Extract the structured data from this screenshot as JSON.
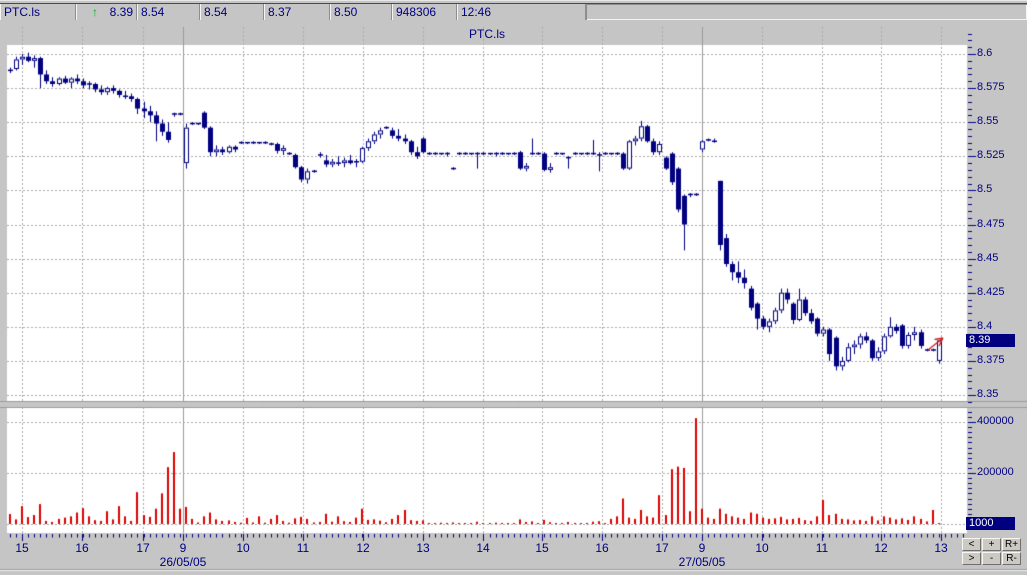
{
  "quote_bar": {
    "symbol": "PTC.ls",
    "up_arrow": "↑",
    "last": "8.39",
    "values": [
      "8.54",
      "8.54",
      "8.37",
      "8.50"
    ],
    "volume": "948306",
    "time": "12:46"
  },
  "nav": {
    "buttons": [
      "<",
      "+",
      "R+",
      ">",
      "-",
      "R-"
    ]
  },
  "colors": {
    "chrome": "#c5c5c5",
    "plot_bg": "#ffffff",
    "navy": "#000080",
    "grid": "#ababab",
    "separator": "#9a9a9a",
    "volume_red": "#dd0000",
    "arrow_red": "#cc2222",
    "up_green": "#00b31e",
    "highlight_bg": "#000080",
    "highlight_text": "#ffffff"
  },
  "chart_data": {
    "type": "candlestick_with_volume",
    "title": "PTC.ls",
    "last_price_label": "8.39",
    "last_volume_label": "1000",
    "y_axis_labels": [
      "8.6",
      "8.575",
      "8.55",
      "8.525",
      "8.5",
      "8.475",
      "8.45",
      "8.425",
      "8.4",
      "8.375",
      "8.35"
    ],
    "y_range": [
      8.35,
      8.6
    ],
    "volume_axis_labels": [
      "400000",
      "200000"
    ],
    "x_hour_ticks": [
      [
        "15",
        22
      ],
      [
        "16",
        82
      ],
      [
        "17",
        143
      ],
      [
        "9",
        183
      ],
      [
        "10",
        243
      ],
      [
        "11",
        303
      ],
      [
        "12",
        363
      ],
      [
        "13",
        423
      ],
      [
        "14",
        483
      ],
      [
        "15",
        542
      ],
      [
        "16",
        602
      ],
      [
        "17",
        662
      ],
      [
        "9",
        702
      ],
      [
        "10",
        762
      ],
      [
        "11",
        822
      ],
      [
        "12",
        881
      ],
      [
        "13",
        941
      ]
    ],
    "x_date_ticks": [
      [
        "26/05/05",
        183
      ],
      [
        "27/05/05",
        702
      ]
    ],
    "day_separators": [
      183,
      702
    ],
    "bars_format": [
      "open",
      "high",
      "low",
      "close",
      "volume"
    ],
    "bars": [
      [
        8.588,
        8.59,
        8.586,
        8.588,
        39000
      ],
      [
        8.589,
        8.598,
        8.588,
        8.596,
        18000
      ],
      [
        8.596,
        8.6,
        8.592,
        8.598,
        70000
      ],
      [
        8.598,
        8.601,
        8.594,
        8.595,
        27000
      ],
      [
        8.595,
        8.599,
        8.59,
        8.597,
        35000
      ],
      [
        8.597,
        8.598,
        8.575,
        8.585,
        78000
      ],
      [
        8.585,
        8.588,
        8.578,
        8.58,
        12000
      ],
      [
        8.58,
        8.583,
        8.576,
        8.578,
        8000
      ],
      [
        8.578,
        8.583,
        8.577,
        8.582,
        20000
      ],
      [
        8.582,
        8.584,
        8.578,
        8.579,
        25000
      ],
      [
        8.579,
        8.583,
        8.575,
        8.582,
        30000
      ],
      [
        8.582,
        8.585,
        8.578,
        8.58,
        45000
      ],
      [
        8.58,
        8.582,
        8.575,
        8.577,
        62000
      ],
      [
        8.577,
        8.58,
        8.574,
        8.578,
        30000
      ],
      [
        8.578,
        8.579,
        8.572,
        8.574,
        15000
      ],
      [
        8.574,
        8.577,
        8.57,
        8.572,
        12000
      ],
      [
        8.572,
        8.576,
        8.57,
        8.575,
        50000
      ],
      [
        8.575,
        8.577,
        8.571,
        8.573,
        18000
      ],
      [
        8.573,
        8.574,
        8.568,
        8.57,
        70000
      ],
      [
        8.57,
        8.573,
        8.567,
        8.569,
        30000
      ],
      [
        8.569,
        8.571,
        8.565,
        8.567,
        12000
      ],
      [
        8.567,
        8.568,
        8.556,
        8.56,
        125000
      ],
      [
        8.56,
        8.565,
        8.553,
        8.558,
        35000
      ],
      [
        8.558,
        8.562,
        8.55,
        8.555,
        28000
      ],
      [
        8.555,
        8.558,
        8.536,
        8.549,
        60000
      ],
      [
        8.549,
        8.552,
        8.54,
        8.543,
        120000
      ],
      [
        8.543,
        8.55,
        8.535,
        8.537,
        223000
      ],
      [
        8.556,
        8.557,
        8.554,
        8.556,
        282000
      ],
      [
        8.556,
        8.557,
        8.555,
        8.556,
        60000
      ],
      [
        8.52,
        8.549,
        8.516,
        8.546,
        67000
      ],
      [
        8.549,
        8.55,
        8.548,
        8.549,
        20000
      ],
      [
        8.549,
        8.549,
        8.548,
        8.549,
        6000
      ],
      [
        8.557,
        8.558,
        8.545,
        8.546,
        30000
      ],
      [
        8.546,
        8.547,
        8.525,
        8.528,
        45000
      ],
      [
        8.528,
        8.533,
        8.525,
        8.53,
        18000
      ],
      [
        8.53,
        8.532,
        8.526,
        8.528,
        12000
      ],
      [
        8.528,
        8.533,
        8.527,
        8.532,
        14000
      ],
      [
        8.532,
        8.533,
        8.528,
        8.53,
        8000
      ],
      [
        8.535,
        8.536,
        8.534,
        8.535,
        5000
      ],
      [
        8.535,
        8.535,
        8.534,
        8.535,
        24000
      ],
      [
        8.535,
        8.536,
        8.534,
        8.535,
        6000
      ],
      [
        8.535,
        8.535,
        8.534,
        8.535,
        30000
      ],
      [
        8.535,
        8.536,
        8.534,
        8.535,
        5000
      ],
      [
        8.535,
        8.535,
        8.533,
        8.534,
        20000
      ],
      [
        8.534,
        8.535,
        8.527,
        8.529,
        35000
      ],
      [
        8.529,
        8.533,
        8.526,
        8.531,
        12000
      ],
      [
        8.527,
        8.528,
        8.526,
        8.527,
        5000
      ],
      [
        8.526,
        8.527,
        8.516,
        8.517,
        22000
      ],
      [
        8.517,
        8.518,
        8.506,
        8.508,
        28000
      ],
      [
        8.508,
        8.516,
        8.505,
        8.514,
        20000
      ],
      [
        8.514,
        8.515,
        8.513,
        8.514,
        6000
      ],
      [
        8.527,
        8.528,
        8.524,
        8.526,
        8000
      ],
      [
        8.522,
        8.526,
        8.517,
        8.519,
        40000
      ],
      [
        8.519,
        8.523,
        8.517,
        8.521,
        9000
      ],
      [
        8.521,
        8.525,
        8.518,
        8.52,
        30000
      ],
      [
        8.52,
        8.524,
        8.517,
        8.522,
        11000
      ],
      [
        8.522,
        8.526,
        8.519,
        8.52,
        8000
      ],
      [
        8.52,
        8.523,
        8.517,
        8.521,
        25000
      ],
      [
        8.521,
        8.532,
        8.52,
        8.531,
        60000
      ],
      [
        8.531,
        8.538,
        8.529,
        8.536,
        16000
      ],
      [
        8.536,
        8.543,
        8.534,
        8.541,
        18000
      ],
      [
        8.541,
        8.546,
        8.538,
        8.544,
        13000
      ],
      [
        8.546,
        8.547,
        8.545,
        8.546,
        7000
      ],
      [
        8.544,
        8.546,
        8.538,
        8.54,
        20000
      ],
      [
        8.54,
        8.545,
        8.536,
        8.538,
        35000
      ],
      [
        8.538,
        8.541,
        8.534,
        8.536,
        55000
      ],
      [
        8.536,
        8.537,
        8.526,
        8.528,
        15000
      ],
      [
        8.528,
        8.532,
        8.523,
        8.525,
        12000
      ],
      [
        8.538,
        8.539,
        8.527,
        8.528,
        14000
      ],
      [
        8.527,
        8.528,
        8.526,
        8.527,
        4000
      ],
      [
        8.527,
        8.528,
        8.526,
        8.527,
        3000
      ],
      [
        8.527,
        8.527,
        8.526,
        8.527,
        5000
      ],
      [
        8.527,
        8.528,
        8.525,
        8.527,
        4000
      ],
      [
        8.516,
        8.517,
        8.515,
        8.516,
        6000
      ],
      [
        8.527,
        8.528,
        8.526,
        8.527,
        3000
      ],
      [
        8.527,
        8.528,
        8.526,
        8.527,
        4000
      ],
      [
        8.527,
        8.527,
        8.526,
        8.527,
        3000
      ],
      [
        8.527,
        8.528,
        8.516,
        8.527,
        9000
      ],
      [
        8.527,
        8.528,
        8.526,
        8.527,
        4000
      ],
      [
        8.527,
        8.527,
        8.526,
        8.527,
        3000
      ],
      [
        8.527,
        8.528,
        8.525,
        8.527,
        5000
      ],
      [
        8.527,
        8.528,
        8.526,
        8.527,
        4000
      ],
      [
        8.527,
        8.527,
        8.526,
        8.527,
        3000
      ],
      [
        8.527,
        8.528,
        8.526,
        8.527,
        4000
      ],
      [
        8.528,
        8.529,
        8.515,
        8.516,
        18000
      ],
      [
        8.516,
        8.52,
        8.514,
        8.518,
        8000
      ],
      [
        8.527,
        8.538,
        8.526,
        8.527,
        10000
      ],
      [
        8.527,
        8.528,
        8.526,
        8.527,
        4000
      ],
      [
        8.527,
        8.528,
        8.514,
        8.515,
        16000
      ],
      [
        8.515,
        8.52,
        8.513,
        8.517,
        7000
      ],
      [
        8.527,
        8.528,
        8.526,
        8.527,
        4000
      ],
      [
        8.527,
        8.527,
        8.526,
        8.527,
        3000
      ],
      [
        8.524,
        8.525,
        8.516,
        8.524,
        8000
      ],
      [
        8.527,
        8.528,
        8.526,
        8.527,
        4000
      ],
      [
        8.527,
        8.527,
        8.526,
        8.527,
        3000
      ],
      [
        8.527,
        8.528,
        8.526,
        8.527,
        4000
      ],
      [
        8.527,
        8.537,
        8.526,
        8.527,
        9000
      ],
      [
        8.527,
        8.528,
        8.514,
        8.526,
        11000
      ],
      [
        8.527,
        8.528,
        8.526,
        8.527,
        4000
      ],
      [
        8.527,
        8.527,
        8.526,
        8.527,
        20000
      ],
      [
        8.527,
        8.528,
        8.526,
        8.527,
        30000
      ],
      [
        8.527,
        8.528,
        8.515,
        8.516,
        100000
      ],
      [
        8.516,
        8.537,
        8.515,
        8.536,
        25000
      ],
      [
        8.536,
        8.54,
        8.533,
        8.538,
        20000
      ],
      [
        8.538,
        8.551,
        8.536,
        8.547,
        55000
      ],
      [
        8.547,
        8.548,
        8.535,
        8.536,
        30000
      ],
      [
        8.536,
        8.538,
        8.526,
        8.528,
        25000
      ],
      [
        8.528,
        8.536,
        8.526,
        8.534,
        113000
      ],
      [
        8.524,
        8.525,
        8.515,
        8.516,
        35000
      ],
      [
        8.527,
        8.528,
        8.504,
        8.506,
        215000
      ],
      [
        8.516,
        8.517,
        8.484,
        8.486,
        225000
      ],
      [
        8.496,
        8.497,
        8.456,
        8.475,
        220000
      ],
      [
        8.497,
        8.498,
        8.495,
        8.497,
        50000
      ],
      [
        8.497,
        8.498,
        8.496,
        8.497,
        415000
      ],
      [
        8.53,
        8.537,
        8.528,
        8.536,
        60000
      ],
      [
        8.537,
        8.538,
        8.536,
        8.537,
        25000
      ],
      [
        8.537,
        8.538,
        8.535,
        8.536,
        20000
      ],
      [
        8.507,
        8.507,
        8.456,
        8.46,
        60000
      ],
      [
        8.465,
        8.468,
        8.444,
        8.446,
        40000
      ],
      [
        8.446,
        8.448,
        8.434,
        8.44,
        30000
      ],
      [
        8.44,
        8.448,
        8.432,
        8.436,
        25000
      ],
      [
        8.436,
        8.442,
        8.428,
        8.432,
        20000
      ],
      [
        8.428,
        8.43,
        8.412,
        8.414,
        45000
      ],
      [
        8.417,
        8.418,
        8.398,
        8.406,
        40000
      ],
      [
        8.406,
        8.408,
        8.398,
        8.4,
        25000
      ],
      [
        8.4,
        8.406,
        8.396,
        8.404,
        20000
      ],
      [
        8.404,
        8.414,
        8.402,
        8.412,
        22000
      ],
      [
        8.412,
        8.428,
        8.41,
        8.425,
        28000
      ],
      [
        8.425,
        8.428,
        8.417,
        8.42,
        18000
      ],
      [
        8.417,
        8.418,
        8.402,
        8.405,
        20000
      ],
      [
        8.405,
        8.428,
        8.404,
        8.42,
        24000
      ],
      [
        8.42,
        8.422,
        8.408,
        8.41,
        15000
      ],
      [
        8.41,
        8.413,
        8.402,
        8.404,
        12000
      ],
      [
        8.406,
        8.407,
        8.393,
        8.395,
        30000
      ],
      [
        8.395,
        8.4,
        8.393,
        8.398,
        94000
      ],
      [
        8.398,
        8.399,
        8.375,
        8.38,
        35000
      ],
      [
        8.392,
        8.393,
        8.368,
        8.371,
        40000
      ],
      [
        8.371,
        8.378,
        8.368,
        8.375,
        20000
      ],
      [
        8.375,
        8.388,
        8.374,
        8.385,
        18000
      ],
      [
        8.385,
        8.39,
        8.38,
        8.387,
        14000
      ],
      [
        8.387,
        8.395,
        8.384,
        8.393,
        16000
      ],
      [
        8.393,
        8.396,
        8.388,
        8.39,
        12000
      ],
      [
        8.39,
        8.391,
        8.375,
        8.377,
        30000
      ],
      [
        8.377,
        8.385,
        8.375,
        8.382,
        14000
      ],
      [
        8.382,
        8.395,
        8.38,
        8.393,
        30000
      ],
      [
        8.393,
        8.407,
        8.392,
        8.4,
        25000
      ],
      [
        8.4,
        8.402,
        8.395,
        8.397,
        18000
      ],
      [
        8.401,
        8.402,
        8.384,
        8.386,
        22000
      ],
      [
        8.386,
        8.396,
        8.384,
        8.394,
        16000
      ],
      [
        8.394,
        8.4,
        8.39,
        8.396,
        30000
      ],
      [
        8.396,
        8.398,
        8.384,
        8.386,
        20000
      ],
      [
        8.383,
        8.384,
        8.382,
        8.383,
        10000
      ],
      [
        8.383,
        8.384,
        8.382,
        8.383,
        55000
      ],
      [
        8.375,
        8.39,
        8.373,
        8.39,
        1000
      ]
    ]
  }
}
